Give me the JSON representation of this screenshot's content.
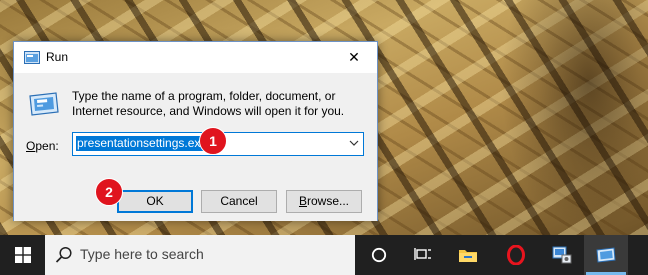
{
  "dialog": {
    "title": "Run",
    "close_glyph": "✕",
    "description": "Type the name of a program, folder, document, or Internet resource, and Windows will open it for you.",
    "open_label_key": "O",
    "open_label_rest": "pen:",
    "open_value": "presentationsettings.exe",
    "buttons": {
      "ok": "OK",
      "cancel": "Cancel",
      "browse_key": "B",
      "browse_rest": "rowse..."
    }
  },
  "badges": {
    "step1": "1",
    "step2": "2"
  },
  "taskbar": {
    "search_placeholder": "Type here to search",
    "icons": [
      "windows-start-icon",
      "cortana-icon",
      "task-view-icon",
      "file-explorer-icon",
      "opera-icon",
      "presentation-settings-icon",
      "run-icon"
    ]
  },
  "colors": {
    "accent": "#0078d7",
    "badge": "#e0141e",
    "taskbar": "#202020"
  }
}
